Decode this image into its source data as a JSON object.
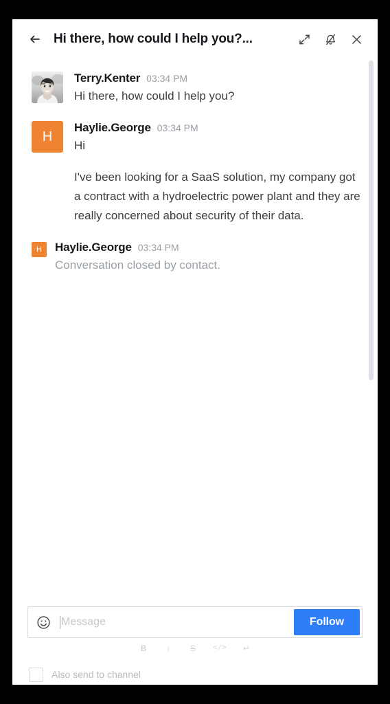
{
  "header": {
    "back_icon": "arrow-left-icon",
    "title": "Hi there, how could I help you?...",
    "expand_icon": "expand-diagonal-icon",
    "mute_icon": "bell-slash-icon",
    "close_icon": "close-x-icon"
  },
  "conversation": {
    "messages": [
      {
        "author": "Terry.Kenter",
        "time": "03:34 PM",
        "avatar_type": "photo",
        "avatar_letter": "",
        "blocks": [
          "Hi there, how could I help you?"
        ],
        "muted": false
      },
      {
        "author": "Haylie.George",
        "time": "03:34 PM",
        "avatar_type": "letter",
        "avatar_letter": "H",
        "blocks": [
          "Hi",
          "I've been looking for a SaaS solution, my company got a contract with a hydroelectric power plant and they are really concerned about security of their data."
        ],
        "muted": false
      },
      {
        "author": "Haylie.George",
        "time": "03:34 PM",
        "avatar_type": "letter-small",
        "avatar_letter": "H",
        "blocks": [
          "Conversation closed by contact."
        ],
        "muted": true
      }
    ]
  },
  "composer": {
    "emoji_icon": "smiley-face-icon",
    "placeholder": "Message",
    "value": "",
    "follow_label": "Follow",
    "format_buttons": [
      {
        "name": "bold",
        "label": "B"
      },
      {
        "name": "italic",
        "label": "i"
      },
      {
        "name": "strikethrough",
        "label": "S"
      },
      {
        "name": "code",
        "label": "</>"
      },
      {
        "name": "line-break",
        "label": "↵"
      }
    ],
    "also_send_label": "Also send to channel",
    "also_send_checked": false
  },
  "colors": {
    "accent_blue": "#2c7df7",
    "avatar_orange": "#ee8432",
    "panel_bg": "#ffffff",
    "screen_bg": "#000000",
    "muted_text": "#9aa0a6"
  }
}
